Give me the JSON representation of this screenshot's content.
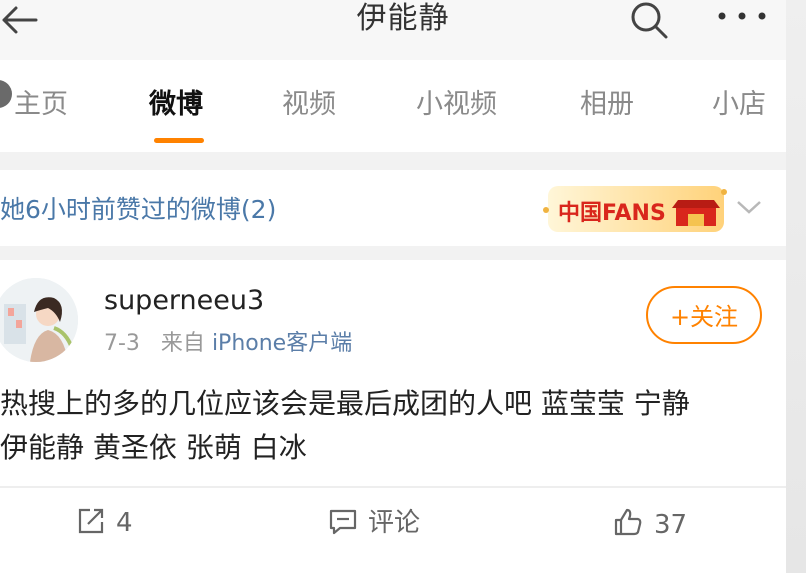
{
  "header": {
    "title": "伊能静",
    "back_icon": "arrow-left-icon",
    "search_icon": "search-icon",
    "more_icon": "more-horizontal-icon"
  },
  "tabs": [
    {
      "label": "主页"
    },
    {
      "label": "微博",
      "active": true
    },
    {
      "label": "视频"
    },
    {
      "label": "小视频"
    },
    {
      "label": "相册"
    },
    {
      "label": "小店"
    }
  ],
  "liked_section": {
    "text": "她6小时前赞过的微博(2)",
    "badge_text": "中国FANS"
  },
  "post": {
    "username": "superneeu3",
    "date": "7-3",
    "source_prefix": "来自",
    "source": "iPhone客户端",
    "follow_label": "+关注",
    "content_line1": "热搜上的多的几位应该会是最后成团的人吧 蓝莹莹 宁静",
    "content_line2": "伊能静 黄圣依 张萌 白冰",
    "actions": {
      "share_count": "4",
      "comment_label": "评论",
      "like_count": "37"
    }
  },
  "colors": {
    "accent": "#ff8200",
    "link": "#4a78a8",
    "muted": "#999999"
  }
}
